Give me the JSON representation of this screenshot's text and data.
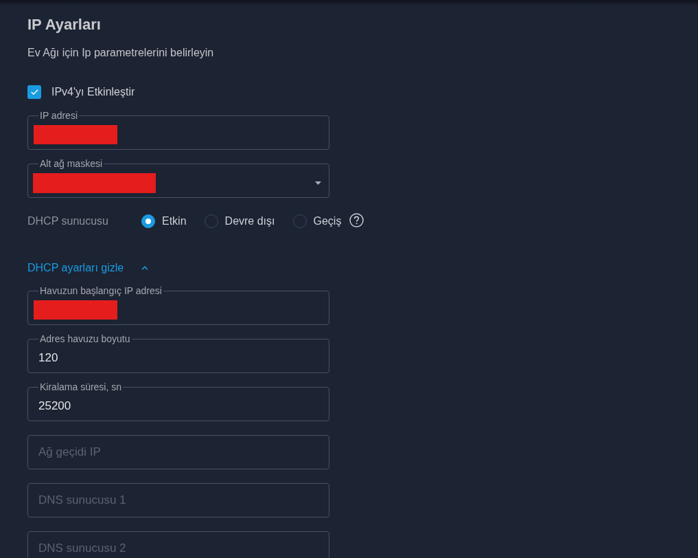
{
  "page": {
    "title": "IP Ayarları",
    "subtitle": "Ev Ağı için Ip parametrelerini belirleyin"
  },
  "ipv4_toggle": {
    "label": "IPv4'yı Etkinleştir",
    "checked": true
  },
  "fields": [
    {
      "kind": "text",
      "label": "IP adresi",
      "redacted": true
    },
    {
      "kind": "select",
      "label": "Alt ağ maskesi",
      "redacted": true
    }
  ],
  "dhcp_server": {
    "label": "DHCP sunucusu",
    "options": [
      {
        "label": "Etkin",
        "selected": true
      },
      {
        "label": "Devre dışı",
        "selected": false
      },
      {
        "label": "Geçiş",
        "selected": false
      }
    ]
  },
  "dhcp_toggle": {
    "label": "DHCP ayarları gizle",
    "expanded": true
  },
  "dhcp_fields": [
    {
      "kind": "text",
      "label": "Havuzun başlangıç IP adresi",
      "redacted": true
    },
    {
      "kind": "text",
      "label": "Adres havuzu boyutu",
      "value": "120",
      "redacted": false
    },
    {
      "kind": "text",
      "label": "Kiralama süresi, sn",
      "value": "25200",
      "redacted": false
    },
    {
      "kind": "text",
      "placeholder": "Ağ geçidi IP",
      "redacted": false
    },
    {
      "kind": "text",
      "placeholder": "DNS sunucusu 1",
      "redacted": false
    },
    {
      "kind": "text",
      "placeholder": "DNS sunucusu 2",
      "redacted": false
    }
  ]
}
